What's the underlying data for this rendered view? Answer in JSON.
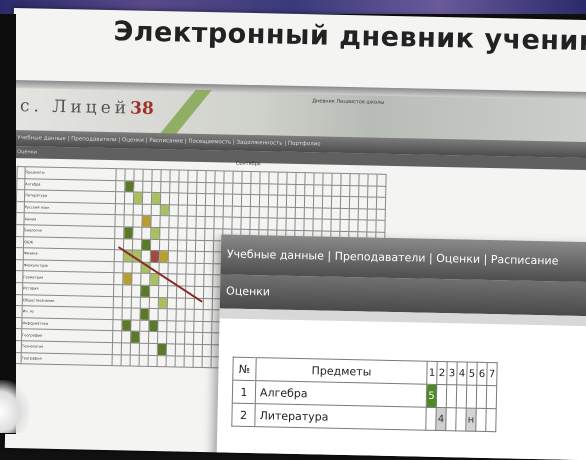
{
  "slide": {
    "title": "Электронный дневник ученика",
    "logo_prefix": "с. Лицей",
    "logo_number": "38",
    "banner_link": "Дневник Лицеистов школы"
  },
  "bg_nav": {
    "items": "Учебные данные | Преподаватели | Оценки | Расписание | Посещаемость | Задолженность | Портфолио",
    "sub": "Оценки"
  },
  "bg_table": {
    "month": "Сентябрь",
    "header_subject": "Предметы",
    "subjects": [
      "Алгебра",
      "Литература",
      "Русский язык",
      "Химия",
      "Биология",
      "ОБЖ",
      "Физика",
      "Физкультура",
      "Геометрия",
      "История",
      "Обществознание",
      "Ин. яз",
      "Информатика",
      "География",
      "Технология",
      "География"
    ],
    "marks": [
      {
        "row": 0,
        "col": 1,
        "color": "g"
      },
      {
        "row": 1,
        "col": 2,
        "color": "l"
      },
      {
        "row": 1,
        "col": 4,
        "color": "l"
      },
      {
        "row": 2,
        "col": 5,
        "color": "l"
      },
      {
        "row": 3,
        "col": 3,
        "color": "y"
      },
      {
        "row": 4,
        "col": 1,
        "color": "g"
      },
      {
        "row": 4,
        "col": 4,
        "color": "l"
      },
      {
        "row": 5,
        "col": 3,
        "color": "g"
      },
      {
        "row": 6,
        "col": 1,
        "color": "l"
      },
      {
        "row": 6,
        "col": 2,
        "color": "l"
      },
      {
        "row": 6,
        "col": 4,
        "color": "r"
      },
      {
        "row": 6,
        "col": 5,
        "color": "y"
      },
      {
        "row": 7,
        "col": 3,
        "color": "l"
      },
      {
        "row": 8,
        "col": 1,
        "color": "y"
      },
      {
        "row": 8,
        "col": 4,
        "color": "l"
      },
      {
        "row": 9,
        "col": 3,
        "color": "g"
      },
      {
        "row": 10,
        "col": 5,
        "color": "l"
      },
      {
        "row": 11,
        "col": 3,
        "color": "g"
      },
      {
        "row": 12,
        "col": 1,
        "color": "g"
      },
      {
        "row": 12,
        "col": 4,
        "color": "g"
      },
      {
        "row": 13,
        "col": 2,
        "color": "g"
      },
      {
        "row": 14,
        "col": 5,
        "color": "g"
      }
    ]
  },
  "fg_window": {
    "menu": "Учебные данные | Преподаватели | Оценки | Расписание",
    "header": "Оценки",
    "col_num": "№",
    "col_subject": "Предметы",
    "days": [
      "1",
      "2",
      "3",
      "4",
      "5",
      "6",
      "7"
    ],
    "rows": [
      {
        "idx": "1",
        "subject": "Алгебра",
        "marks": {
          "1": "5"
        }
      },
      {
        "idx": "2",
        "subject": "Литература",
        "marks": {
          "2": "4",
          "5": "н"
        }
      }
    ]
  },
  "colors": {
    "mark_green": "#4e8a24",
    "logo_red": "#a0302a",
    "menu_gray": "#5a5a5a"
  }
}
